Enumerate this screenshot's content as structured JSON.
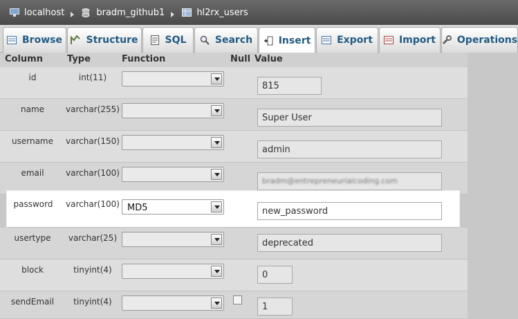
{
  "breadcrumb": {
    "items": [
      {
        "label": "localhost",
        "icon": "server-icon"
      },
      {
        "label": "bradm_github1",
        "icon": "database-icon"
      },
      {
        "label": "hl2rx_users",
        "icon": "table-icon"
      }
    ]
  },
  "tabs": [
    {
      "label": "Browse",
      "icon": "browse-icon",
      "active": false
    },
    {
      "label": "Structure",
      "icon": "structure-icon",
      "active": false
    },
    {
      "label": "SQL",
      "icon": "sql-icon",
      "active": false
    },
    {
      "label": "Search",
      "icon": "search-icon",
      "active": false
    },
    {
      "label": "Insert",
      "icon": "insert-icon",
      "active": true
    },
    {
      "label": "Export",
      "icon": "export-icon",
      "active": false
    },
    {
      "label": "Import",
      "icon": "import-icon",
      "active": false
    },
    {
      "label": "Operations",
      "icon": "wrench-icon",
      "active": false
    }
  ],
  "table": {
    "headers": {
      "column": "Column",
      "type": "Type",
      "function": "Function",
      "null": "Null",
      "value": "Value"
    },
    "rows": [
      {
        "column": "id",
        "type": "int(11)",
        "function": "",
        "value": "815"
      },
      {
        "column": "name",
        "type": "varchar(255)",
        "function": "",
        "value": "Super User"
      },
      {
        "column": "username",
        "type": "varchar(150)",
        "function": "",
        "value": "admin"
      },
      {
        "column": "email",
        "type": "varchar(100)",
        "function": "",
        "value": "bradm@entrepreneurialcoding.com"
      },
      {
        "column": "password",
        "type": "varchar(100)",
        "function": "MD5",
        "value": "new_password"
      },
      {
        "column": "usertype",
        "type": "varchar(25)",
        "function": "",
        "value": "deprecated"
      },
      {
        "column": "block",
        "type": "tinyint(4)",
        "function": "",
        "value": "0"
      },
      {
        "column": "sendEmail",
        "type": "tinyint(4)",
        "function": "",
        "value": "1"
      }
    ]
  }
}
